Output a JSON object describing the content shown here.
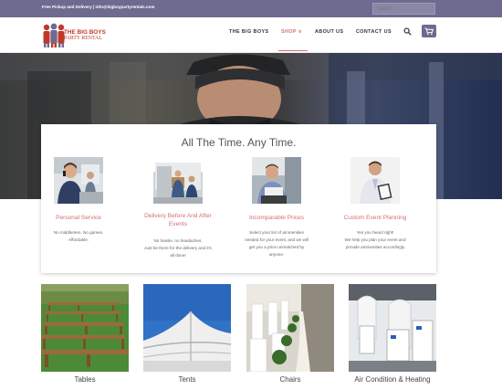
{
  "topbar": {
    "contact_text": "Free Pickup and Delivery | info@bigboypartyrentals.com",
    "search_placeholder": "Search"
  },
  "logo": {
    "line1": "THE BIG BOYS",
    "line2": "PARTY RENTAL"
  },
  "nav": {
    "items": [
      "THE BIG BOYS",
      "SHOP ∨",
      "ABOUT US",
      "CONTACT US"
    ],
    "active": "SHOP ∨",
    "accent": "#d46f72"
  },
  "icons": {
    "search": "search-icon",
    "cart": "cart-icon"
  },
  "brand": {
    "purple": "#6f6a8f",
    "pink": "#d46f72"
  },
  "services": {
    "title": "All The Time. Any Time.",
    "items": [
      {
        "title": "Personal Service",
        "lines": [
          "No middlemen. No games.",
          "Affordable."
        ]
      },
      {
        "title_lines": [
          "Delivery Before And After",
          "Events"
        ],
        "lines": [
          "No hassle, no headaches.",
          "Just be there for the delivery and it's",
          "all done!"
        ]
      },
      {
        "title": "Incomparable Prices",
        "lines": [
          "Select your list of ammenities",
          "needed for your event, and we will",
          "get you a price unmatched by",
          "anyone."
        ]
      },
      {
        "title": "Custom Event Planning",
        "lines": [
          "Yes you heard right!",
          "We help you plan your event and",
          "provide ammenities accordingly"
        ]
      }
    ]
  },
  "gallery": {
    "items": [
      "Tables",
      "Tents",
      "Chairs",
      "Air Condition & Heating"
    ]
  }
}
